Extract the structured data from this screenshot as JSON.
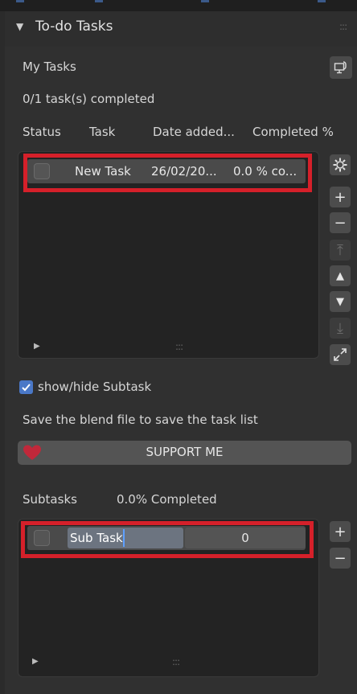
{
  "panel": {
    "title": "To-do Tasks",
    "collapse_icon": "triangle-down-icon"
  },
  "tasks": {
    "section_label": "My Tasks",
    "completed_summary": "0/1 task(s) completed",
    "columns": [
      "Status",
      "Task",
      "Date added...",
      "Completed %"
    ],
    "rows": [
      {
        "checked": false,
        "name": "New Task",
        "date": "26/02/20...",
        "completed": "0.0 % co..."
      }
    ]
  },
  "subtask_toggle": {
    "checked": true,
    "label": "show/hide Subtask"
  },
  "save_note": "Save the blend file to save the task list",
  "support_button": {
    "label": "SUPPORT ME",
    "icon": "heart-icon"
  },
  "subtasks": {
    "section_label": "Subtasks",
    "completed_summary": "0.0% Completed",
    "rows": [
      {
        "checked": false,
        "name": "Sub Task",
        "value": "0"
      }
    ]
  },
  "colors": {
    "highlight_red": "#d5202a",
    "heart_red": "#c0283a",
    "checkbox_blue": "#4a78c7"
  }
}
